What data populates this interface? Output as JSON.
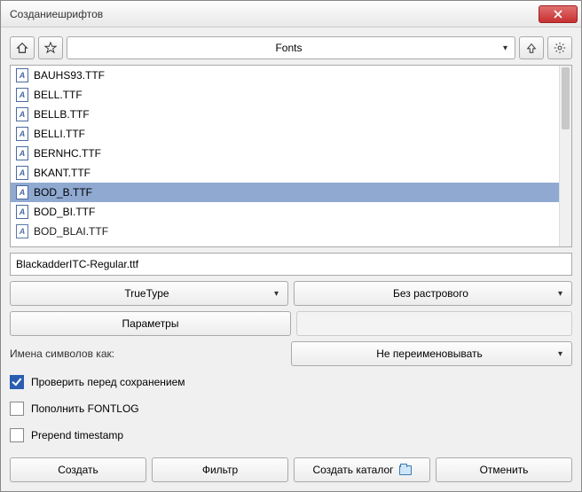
{
  "window": {
    "title": "Созданиешрифтов"
  },
  "path": {
    "label": "Fonts"
  },
  "files": [
    {
      "name": "BAUHS93.TTF",
      "selected": false
    },
    {
      "name": "BELL.TTF",
      "selected": false
    },
    {
      "name": "BELLB.TTF",
      "selected": false
    },
    {
      "name": "BELLI.TTF",
      "selected": false
    },
    {
      "name": "BERNHC.TTF",
      "selected": false
    },
    {
      "name": "BKANT.TTF",
      "selected": false
    },
    {
      "name": "BOD_B.TTF",
      "selected": true
    },
    {
      "name": "BOD_BI.TTF",
      "selected": false
    },
    {
      "name": "BOD_BLAI.TTF",
      "selected": false,
      "cut": true
    }
  ],
  "filename": {
    "value": "BlackadderITC-Regular.ttf"
  },
  "format": {
    "label": "TrueType"
  },
  "raster": {
    "label": "Без растрового"
  },
  "params_btn": "Параметры",
  "symbol_names": {
    "label": "Имена символов как:",
    "value": "Не переименовывать"
  },
  "checks": {
    "validate": {
      "label": "Проверить перед сохранением",
      "checked": true
    },
    "fontlog": {
      "label": "Пополнить FONTLOG",
      "checked": false
    },
    "timestamp": {
      "label": "Prepend timestamp",
      "checked": false
    }
  },
  "buttons": {
    "create": "Создать",
    "filter": "Фильтр",
    "catalog": "Создать каталог",
    "cancel": "Отменить"
  }
}
